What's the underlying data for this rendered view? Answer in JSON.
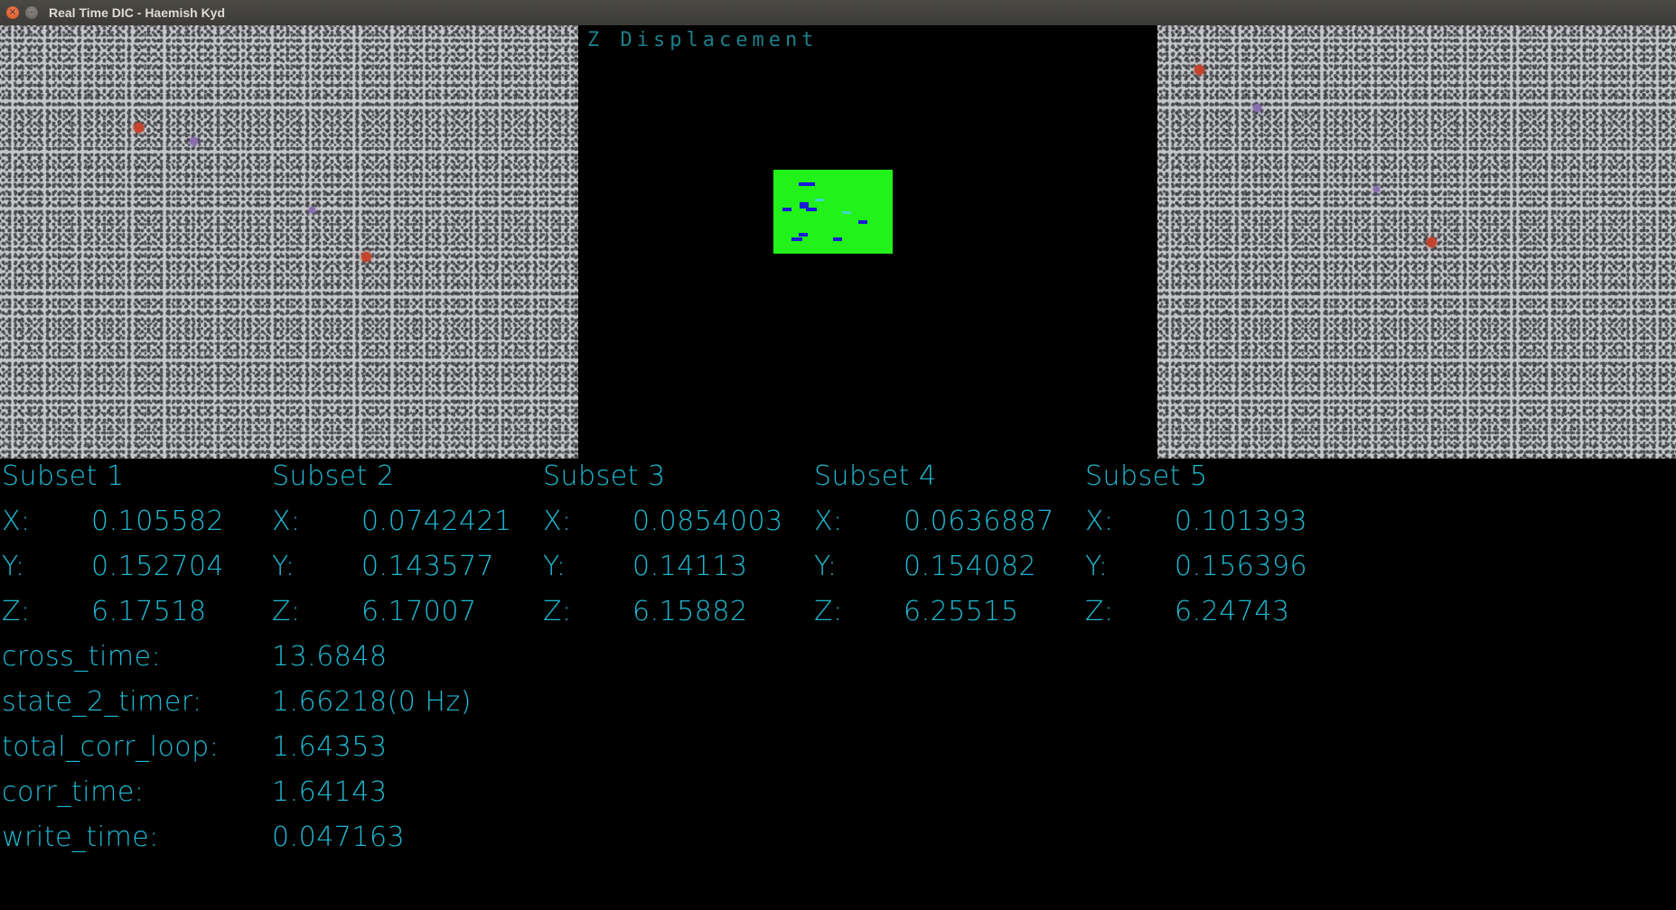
{
  "window": {
    "title": "Real Time DIC - Haemish Kyd",
    "close_glyph": "×",
    "minimize_glyph": "–"
  },
  "center_panel": {
    "label": "Z Displacement",
    "field_color": "#21f21a",
    "vector_color": "#1a1ad9",
    "vector_alt_color": "#3dd9c6"
  },
  "text_color": "#1fb9d2",
  "subsets": [
    {
      "name": "Subset 1",
      "x_label": "X:",
      "x": "0.105582",
      "y_label": "Y:",
      "y": "0.152704",
      "z_label": "Z:",
      "z": "6.17518"
    },
    {
      "name": "Subset 2",
      "x_label": "X:",
      "x": "0.0742421",
      "y_label": "Y:",
      "y": "0.143577",
      "z_label": "Z:",
      "z": "6.17007"
    },
    {
      "name": "Subset 3",
      "x_label": "X:",
      "x": "0.0854003",
      "y_label": "Y:",
      "y": "0.14113",
      "z_label": "Z:",
      "z": "6.15882"
    },
    {
      "name": "Subset 4",
      "x_label": "X:",
      "x": "0.0636887",
      "y_label": "Y:",
      "y": "0.154082",
      "z_label": "Z:",
      "z": "6.25515"
    },
    {
      "name": "Subset 5",
      "x_label": "X:",
      "x": "0.101393",
      "y_label": "Y:",
      "y": "0.156396",
      "z_label": "Z:",
      "z": "6.24743"
    }
  ],
  "timers": [
    {
      "label": "cross_time:",
      "value": "13.6848"
    },
    {
      "label": "state_2_timer:",
      "value": "1.66218(0 Hz)"
    },
    {
      "label": "total_corr_loop:",
      "value": "1.64353"
    },
    {
      "label": "corr_time:",
      "value": "1.64143"
    },
    {
      "label": "write_time:",
      "value": "0.047163"
    }
  ]
}
